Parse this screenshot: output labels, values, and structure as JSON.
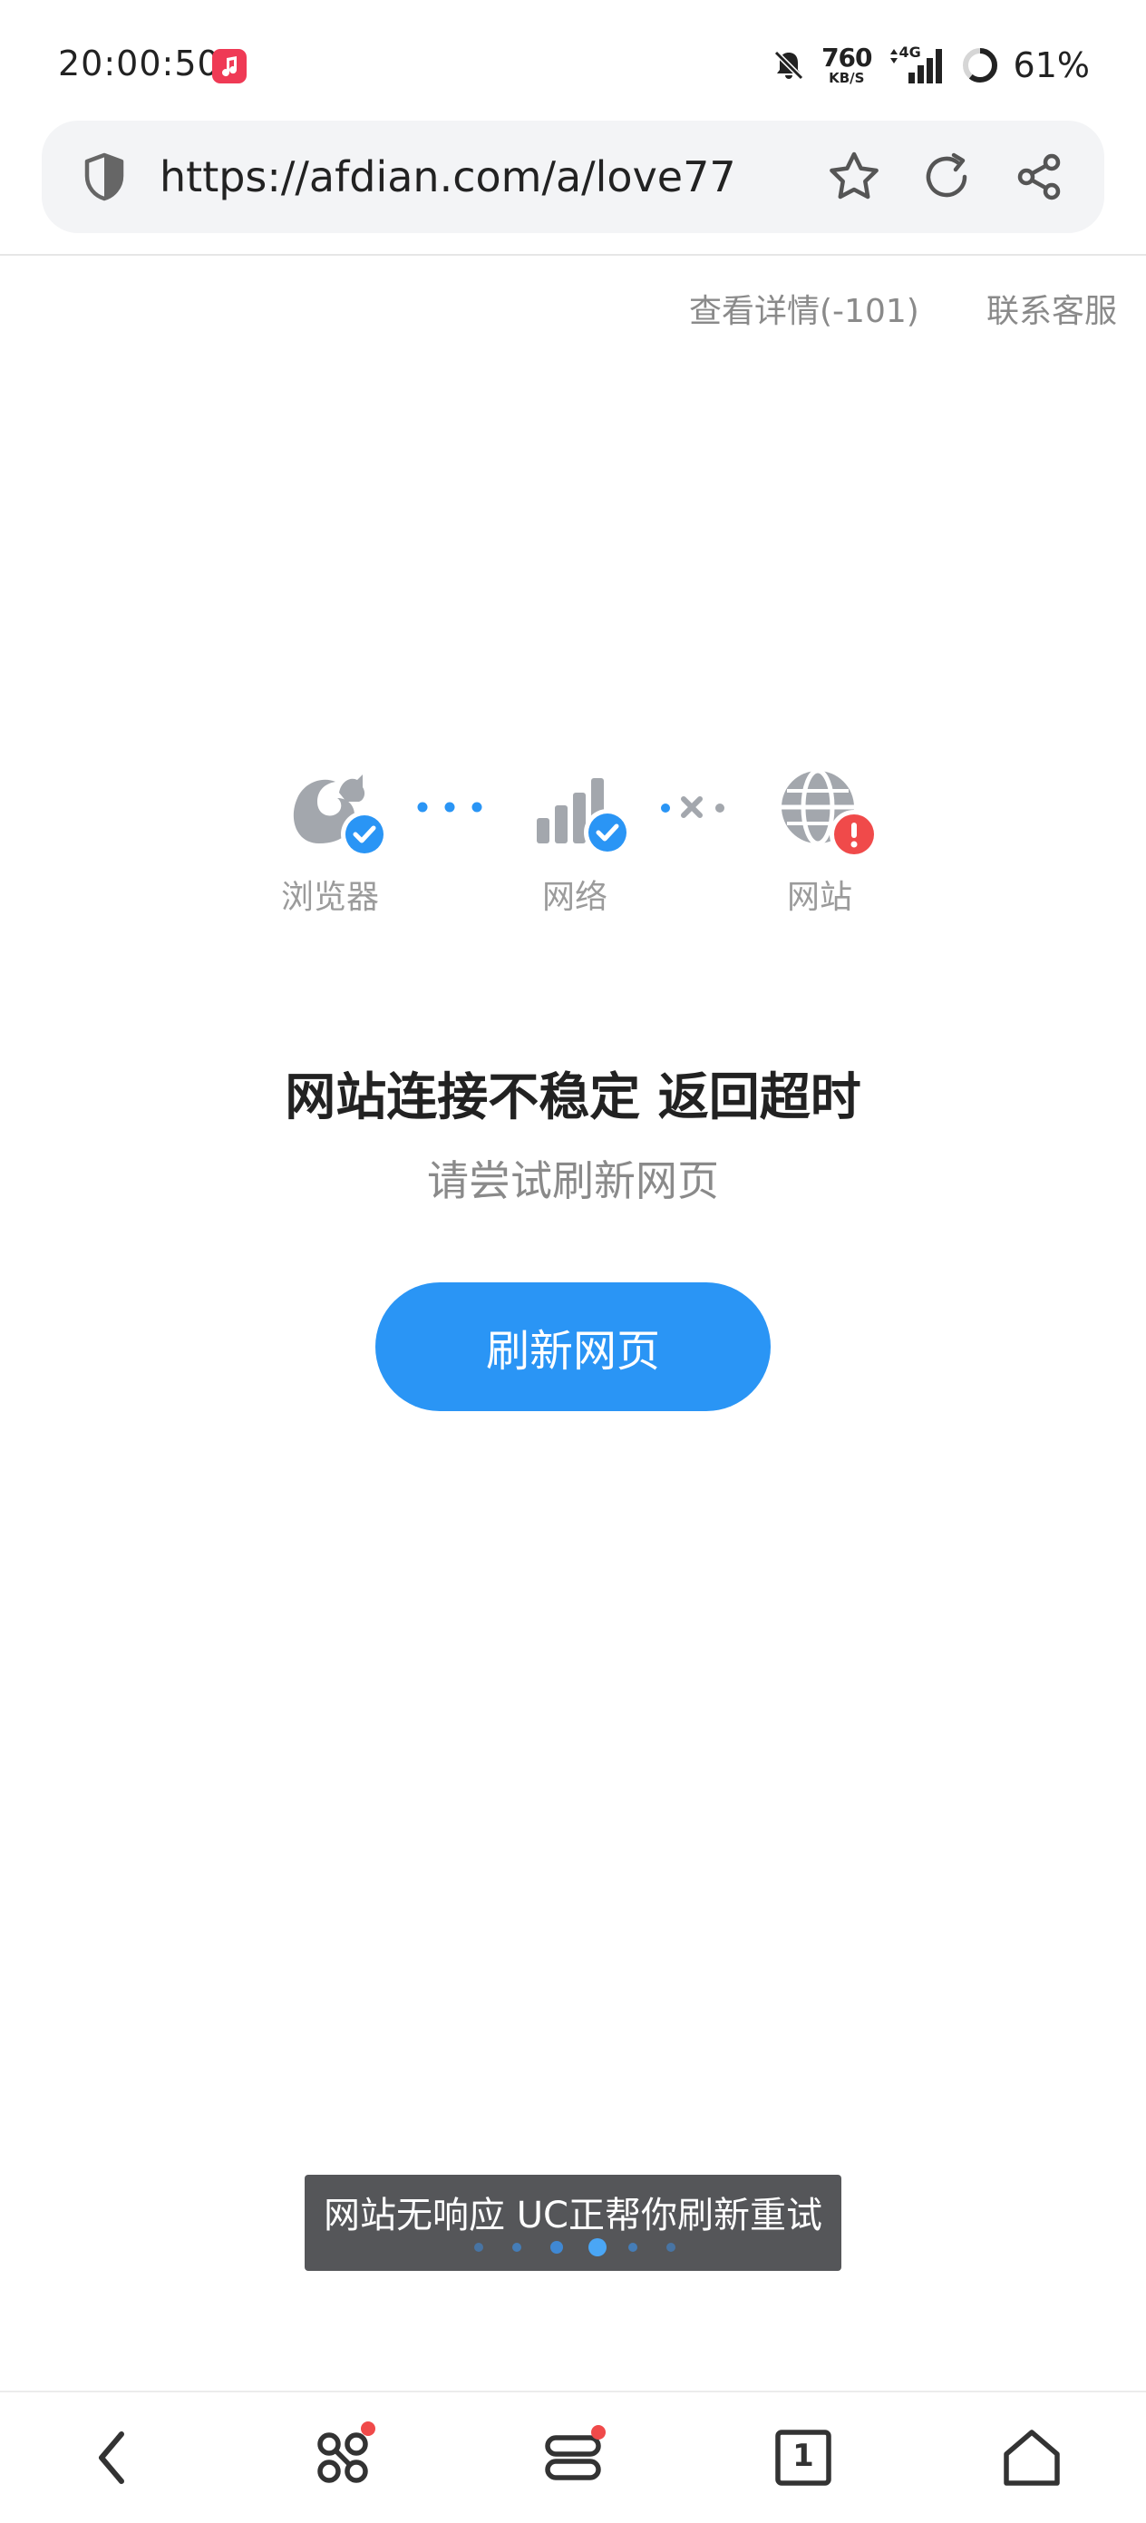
{
  "status_bar": {
    "time": "20:00:50",
    "speed_value": "760",
    "speed_unit": "KB/S",
    "network": "4G",
    "battery": "61%"
  },
  "url_bar": {
    "url": "https://afdian.com/a/love77"
  },
  "links": {
    "details": "查看详情(-101)",
    "support": "联系客服"
  },
  "diagnosis": {
    "browser_label": "浏览器",
    "network_label": "网络",
    "site_label": "网站"
  },
  "error": {
    "title": "网站连接不稳定 返回超时",
    "subtitle": "请尝试刷新网页",
    "refresh_label": "刷新网页"
  },
  "toast": {
    "message": "网站无响应 UC正帮你刷新重试"
  },
  "bottom_nav": {
    "tab_count": "1"
  },
  "colors": {
    "accent": "#2a95f5",
    "error_red": "#f04a4a",
    "icon_gray": "#a3a7ad"
  }
}
